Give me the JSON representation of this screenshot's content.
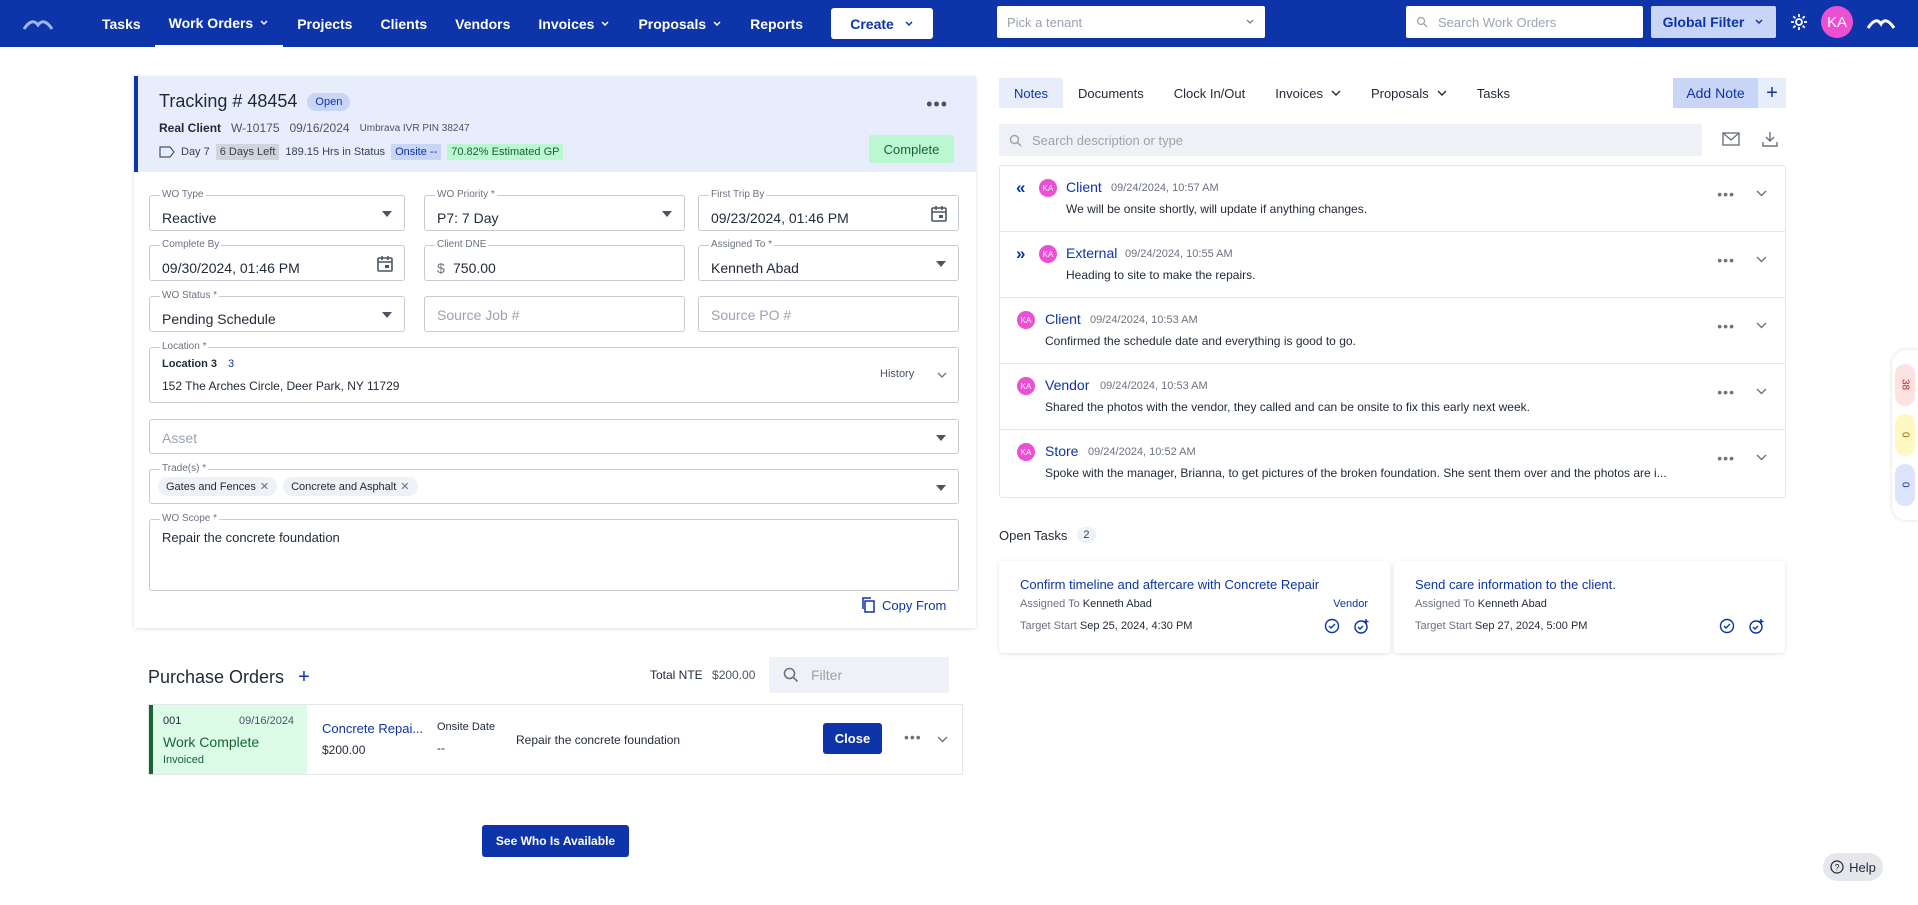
{
  "nav": {
    "items": [
      {
        "label": "Tasks",
        "dropdown": false,
        "active": false
      },
      {
        "label": "Work Orders",
        "dropdown": true,
        "active": true
      },
      {
        "label": "Projects",
        "dropdown": false,
        "active": false
      },
      {
        "label": "Clients",
        "dropdown": false,
        "active": false
      },
      {
        "label": "Vendors",
        "dropdown": false,
        "active": false
      },
      {
        "label": "Invoices",
        "dropdown": true,
        "active": false
      },
      {
        "label": "Proposals",
        "dropdown": true,
        "active": false
      },
      {
        "label": "Reports",
        "dropdown": false,
        "active": false
      }
    ],
    "create_label": "Create",
    "tenant_placeholder": "Pick a tenant",
    "search_placeholder": "Search Work Orders",
    "global_filter_label": "Global Filter",
    "avatar_initials": "KA"
  },
  "wo": {
    "title": "Tracking # 48454",
    "status_badge": "Open",
    "client": "Real Client",
    "wo_number": "W-10175",
    "date": "09/16/2024",
    "ivr": "Umbrava IVR PIN 38247",
    "day": "Day 7",
    "days_left": "6 Days Left",
    "hrs_in_status": "189.15 Hrs in Status",
    "onsite": "Onsite --",
    "gp": "70.82% Estimated GP",
    "complete_label": "Complete",
    "copy_from_label": "Copy From"
  },
  "fields": {
    "wo_type": {
      "label": "WO Type",
      "value": "Reactive"
    },
    "wo_priority": {
      "label": "WO Priority *",
      "value": "P7: 7 Day"
    },
    "first_trip_by": {
      "label": "First Trip By",
      "value": "09/23/2024, 01:46 PM"
    },
    "complete_by": {
      "label": "Complete By",
      "value": "09/30/2024, 01:46 PM"
    },
    "client_dne": {
      "label": "Client DNE",
      "currency": "$",
      "value": "750.00"
    },
    "assigned_to": {
      "label": "Assigned To *",
      "value": "Kenneth Abad"
    },
    "wo_status": {
      "label": "WO Status *",
      "value": "Pending Schedule"
    },
    "source_job": {
      "placeholder": "Source Job #"
    },
    "source_po": {
      "placeholder": "Source PO #"
    },
    "location": {
      "label": "Location *",
      "name": "Location 3",
      "number": "3",
      "address": "152 The Arches Circle, Deer Park, NY 11729",
      "history_label": "History"
    },
    "asset": {
      "placeholder": "Asset"
    },
    "trades": {
      "label": "Trade(s) *",
      "chips": [
        "Gates and Fences",
        "Concrete and Asphalt"
      ]
    },
    "scope": {
      "label": "WO Scope *",
      "value": "Repair the concrete foundation"
    }
  },
  "purchase_orders": {
    "title": "Purchase Orders",
    "total_nte_label": "Total NTE",
    "total_nte_value": "$200.00",
    "filter_placeholder": "Filter",
    "rows": [
      {
        "number": "001",
        "date": "09/16/2024",
        "status": "Work Complete",
        "sub_status": "Invoiced",
        "vendor": "Concrete Repai...",
        "amount": "$200.00",
        "onsite_label": "Onsite Date",
        "onsite_value": "--",
        "description": "Repair the concrete foundation",
        "close_label": "Close"
      }
    ],
    "see_who_label": "See Who Is Available"
  },
  "right_tabs": [
    {
      "label": "Notes",
      "dropdown": false,
      "active": true
    },
    {
      "label": "Documents",
      "dropdown": false,
      "active": false
    },
    {
      "label": "Clock In/Out",
      "dropdown": false,
      "active": false
    },
    {
      "label": "Invoices",
      "dropdown": true,
      "active": false
    },
    {
      "label": "Proposals",
      "dropdown": true,
      "active": false
    },
    {
      "label": "Tasks",
      "dropdown": false,
      "active": false
    }
  ],
  "add_note_label": "Add Note",
  "note_search_placeholder": "Search description or type",
  "notes": [
    {
      "direction": "in",
      "initials": "KA",
      "type": "Client",
      "time": "09/24/2024, 10:57 AM",
      "text": "We will be onsite shortly, will update if anything changes."
    },
    {
      "direction": "out",
      "initials": "KA",
      "type": "External",
      "time": "09/24/2024, 10:55 AM",
      "text": "Heading to site to make the repairs."
    },
    {
      "direction": "",
      "initials": "KA",
      "type": "Client",
      "time": "09/24/2024, 10:53 AM",
      "text": "Confirmed the schedule date and everything is good to go."
    },
    {
      "direction": "",
      "initials": "KA",
      "type": "Vendor",
      "time": "09/24/2024, 10:53 AM",
      "text": "Shared the photos with the vendor, they called and can be onsite to fix this early next week."
    },
    {
      "direction": "",
      "initials": "KA",
      "type": "Store",
      "time": "09/24/2024, 10:52 AM",
      "text": "Spoke with the manager, Brianna, to get pictures of the broken foundation. She sent them over and the photos are i..."
    }
  ],
  "open_tasks": {
    "label": "Open Tasks",
    "count": "2",
    "items": [
      {
        "title": "Confirm timeline and aftercare with Concrete Repair",
        "assigned_label": "Assigned To",
        "assigned": "Kenneth Abad",
        "tag": "Vendor",
        "start_label": "Target Start",
        "start": "Sep 25, 2024, 4:30 PM"
      },
      {
        "title": "Send care information to the client.",
        "assigned_label": "Assigned To",
        "assigned": "Kenneth Abad",
        "tag": "",
        "start_label": "Target Start",
        "start": "Sep 27, 2024, 5:00 PM"
      }
    ]
  },
  "side_counts": [
    "38",
    "0",
    "0"
  ],
  "help_label": "Help"
}
